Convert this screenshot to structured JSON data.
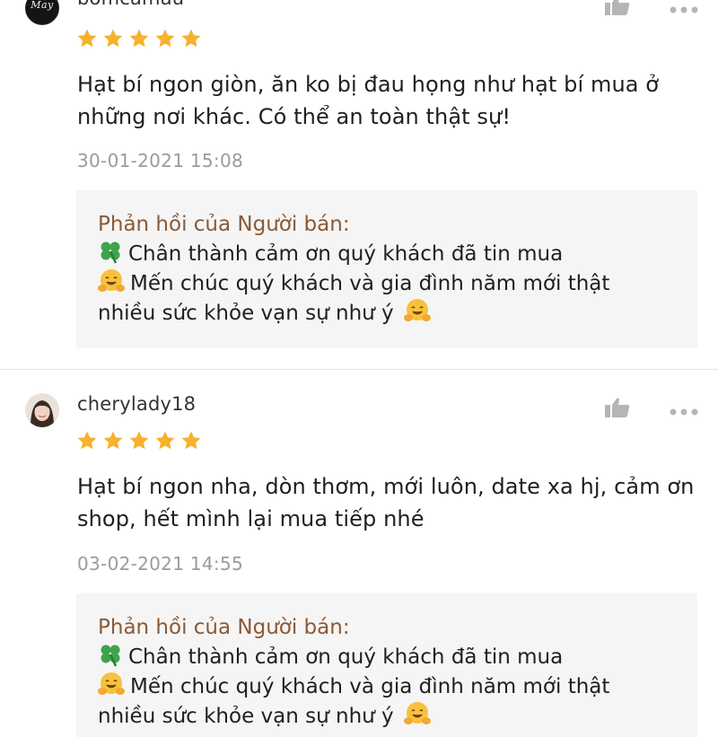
{
  "reviews": [
    {
      "username": "bomcamau",
      "avatar": "logo-avatar",
      "avatar_text": "May",
      "rating": 5,
      "comment": "Hạt bí ngon giòn, ăn ko bị đau họng như hạt bí mua ở những nơi khác. Có thể an toàn thật sự!",
      "date": "30-01-2021 15:08",
      "reply": {
        "title": "Phản hồi của Người bán:",
        "line1": "Chân thành cảm ơn quý khách đã tin mua",
        "line2": "Mến chúc quý khách và gia đình năm mới thật",
        "line3": "nhiều sức khỏe vạn sự như ý"
      }
    },
    {
      "username": "cherylady18",
      "avatar": "photo-avatar",
      "rating": 5,
      "comment": "Hạt bí ngon nha, dòn thơm,  mới luôn, date xa hj, cảm ơn shop, hết mình lại mua tiếp nhé",
      "date": "03-02-2021 14:55",
      "reply": {
        "title": "Phản hồi của Người bán:",
        "line1": "Chân thành cảm ơn quý khách đã tin mua",
        "line2": "Mến chúc quý khách và gia đình năm mới thật",
        "line3": "nhiều sức khỏe vạn sự như ý"
      }
    }
  ],
  "icons": {
    "like": "thumbs-up-icon",
    "more": "more-options-icon",
    "star": "star-icon",
    "clover": "four-leaf-clover-emoji",
    "hug": "hugging-face-emoji"
  },
  "colors": {
    "star": "#f6b12d",
    "reply_title": "#8a5a36",
    "date": "#9b9b9b",
    "reply_bg": "#f5f5f5",
    "icon_gray": "#b5b5b5"
  }
}
